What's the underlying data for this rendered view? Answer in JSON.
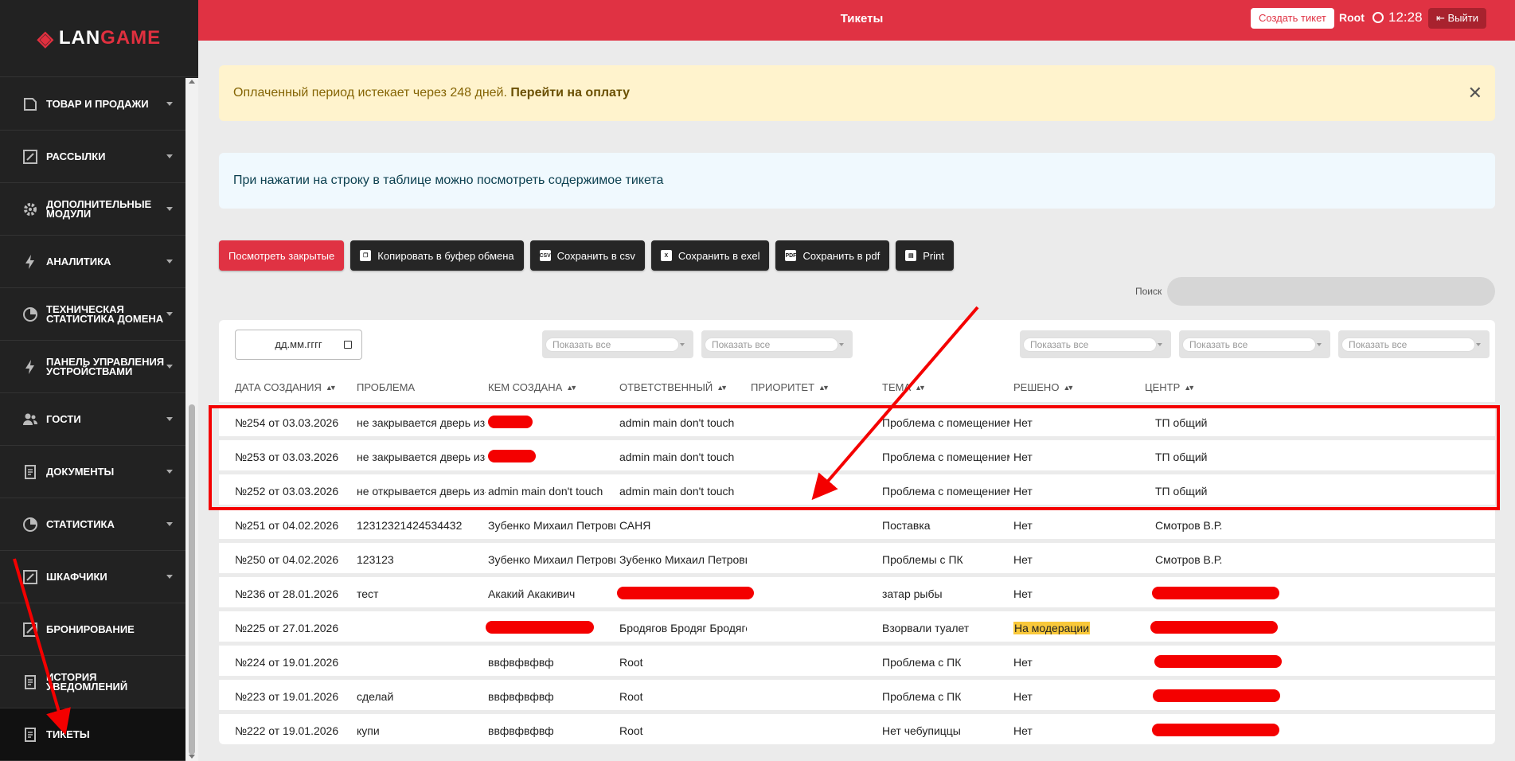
{
  "sidebar": {
    "logo": {
      "prefix": "LAN",
      "suffix": "GAME"
    },
    "items": [
      {
        "label": "ТОВАР И ПРОДАЖИ",
        "icon": "edit-doc-icon",
        "chevron": true
      },
      {
        "label": "РАССЫЛКИ",
        "icon": "pencil-box-icon",
        "chevron": true
      },
      {
        "label": "ДОПОЛНИТЕЛЬНЫЕ МОДУЛИ",
        "icon": "gear-icon",
        "chevron": true
      },
      {
        "label": "АНАЛИТИКА",
        "icon": "bolt-icon",
        "chevron": true
      },
      {
        "label": "ТЕХНИЧЕСКАЯ СТАТИСТИКА ДОМЕНА",
        "icon": "pie-chart-icon",
        "chevron": true
      },
      {
        "label": "ПАНЕЛЬ УПРАВЛЕНИЯ УСТРОЙСТВАМИ",
        "icon": "bolt-icon",
        "chevron": true
      },
      {
        "label": "ГОСТИ",
        "icon": "users-icon",
        "chevron": true
      },
      {
        "label": "ДОКУМЕНТЫ",
        "icon": "document-icon",
        "chevron": true
      },
      {
        "label": "СТАТИСТИКА",
        "icon": "pie-chart-icon",
        "chevron": true
      },
      {
        "label": "ШКАФЧИКИ",
        "icon": "pencil-box-icon",
        "chevron": true
      },
      {
        "label": "БРОНИРОВАНИЕ",
        "icon": "pencil-box-icon",
        "chevron": false
      },
      {
        "label": "ИСТОРИЯ УВЕДОМЛЕНИЙ",
        "icon": "document-icon",
        "chevron": false
      },
      {
        "label": "ТИКЕТЫ",
        "icon": "document-icon",
        "chevron": false,
        "active": true
      }
    ]
  },
  "header": {
    "title": "Тикеты",
    "create_button": "Создать тикет",
    "user": "Root",
    "time": "12:28",
    "logout": "Выйти"
  },
  "alert": {
    "text": "Оплаченный период истекает через 248 дней.",
    "link": "Перейти на оплату"
  },
  "info": {
    "text": "При нажатии на строку в таблице можно посмотреть содержимое тикета"
  },
  "toolbar": {
    "closed": "Посмотреть закрытые",
    "copy": "Копировать в буфер обмена",
    "csv": "Сохранить в csv",
    "excel": "Сохранить в exel",
    "pdf": "Сохранить в pdf",
    "print": "Print"
  },
  "search": {
    "label": "Поиск",
    "value": ""
  },
  "filters": {
    "date_placeholder": "дд.мм.гггг",
    "select_default": "Показать все"
  },
  "columns": [
    "ДАТА СОЗДАНИЯ",
    "ПРОБЛЕМА",
    "КЕМ СОЗДАНА",
    "ОТВЕТСТВЕННЫЙ",
    "ПРИОРИТЕТ",
    "ТЕМА",
    "РЕШЕНО",
    "ЦЕНТР"
  ],
  "rows": [
    {
      "date": "№254 от 03.03.2026",
      "problem": "не закрывается дверь из-за снега",
      "creator": "",
      "responsible": "admin main don't touch",
      "priority": "",
      "topic": "Проблема с помещением",
      "solved": "Нет",
      "center": "ТП общий"
    },
    {
      "date": "№253 от 03.03.2026",
      "problem": "не закрывается дверь из-за снега",
      "creator": "",
      "responsible": "admin main don't touch",
      "priority": "",
      "topic": "Проблема с помещением",
      "solved": "Нет",
      "center": "ТП общий"
    },
    {
      "date": "№252 от 03.03.2026",
      "problem": "не открывается дверь из-за снега",
      "creator": "admin main don't touch",
      "responsible": "admin main don't touch",
      "priority": "",
      "topic": "Проблема с помещением",
      "solved": "Нет",
      "center": "ТП общий"
    },
    {
      "date": "№251 от 04.02.2026",
      "problem": "12312321424534432",
      "creator": "Зубенко Михаил Петрович",
      "responsible": "САНЯ",
      "priority": "",
      "topic": "Поставка",
      "solved": "Нет",
      "center": "Смотров В.Р."
    },
    {
      "date": "№250 от 04.02.2026",
      "problem": "123123",
      "creator": "Зубенко Михаил Петрович",
      "responsible": "Зубенко Михаил Петрович",
      "priority": "",
      "topic": "Проблемы с ПК",
      "solved": "Нет",
      "center": "Смотров В.Р."
    },
    {
      "date": "№236 от 28.01.2026",
      "problem": "тест",
      "creator": "Акакий Акакивич",
      "responsible": "",
      "priority": "",
      "topic": "затар рыбы",
      "solved": "Нет",
      "center": ""
    },
    {
      "date": "№225 от 27.01.2026",
      "problem": "",
      "creator": "",
      "responsible": "Бродягов Бродяг Бродягович",
      "priority": "",
      "topic": "Взорвали туалет",
      "solved": "На модерации",
      "center": ""
    },
    {
      "date": "№224 от 19.01.2026",
      "problem": "",
      "creator": "ввфвфвфвф",
      "responsible": "Root",
      "priority": "",
      "topic": "Проблема с ПК",
      "solved": "Нет",
      "center": ""
    },
    {
      "date": "№223 от 19.01.2026",
      "problem": "сделай",
      "creator": "ввфвфвфвф",
      "responsible": "Root",
      "priority": "",
      "topic": "Проблема с ПК",
      "solved": "Нет",
      "center": ""
    },
    {
      "date": "№222 от 19.01.2026",
      "problem": "купи",
      "creator": "ввфвфвфвф",
      "responsible": "Root",
      "priority": "",
      "topic": "Нет чебупиццы",
      "solved": "Нет",
      "center": ""
    }
  ],
  "colors": {
    "brand": "#e03243",
    "annotation": "#f40000",
    "badge": "#f9c83a"
  }
}
